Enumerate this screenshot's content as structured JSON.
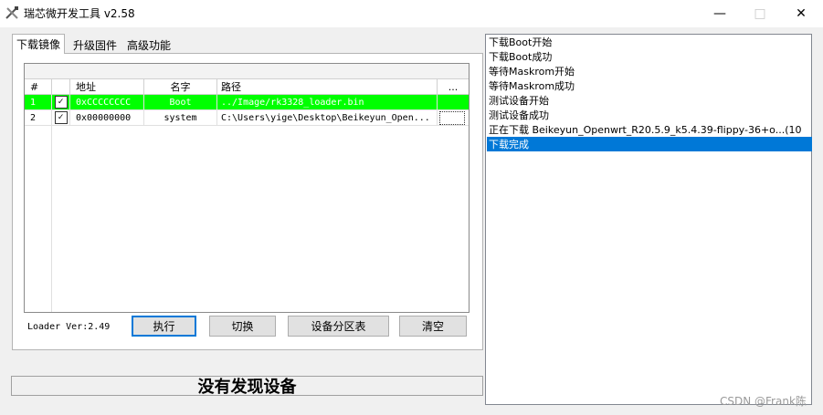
{
  "window": {
    "title": "瑞芯微开发工具 v2.58",
    "minimize_icon": "minimize-icon",
    "maximize_icon": "maximize-icon",
    "close_icon": "close-icon"
  },
  "tabs": [
    {
      "label": "下载镜像",
      "active": true
    },
    {
      "label": "升级固件",
      "active": false
    },
    {
      "label": "高级功能",
      "active": false
    }
  ],
  "table": {
    "headers": {
      "num": "#",
      "check": "",
      "address": "地址",
      "name": "名字",
      "path": "路径",
      "more": "..."
    },
    "rows": [
      {
        "num": "1",
        "checked": true,
        "address": "0xCCCCCCCC",
        "name": "Boot",
        "path": "../Image/rk3328_loader.bin"
      },
      {
        "num": "2",
        "checked": true,
        "address": "0x00000000",
        "name": "system",
        "path": "C:\\Users\\yige\\Desktop\\Beikeyun_Open..."
      }
    ],
    "highlight_color": "#00ff00"
  },
  "loader_version": "Loader Ver:2.49",
  "buttons": {
    "run": "执行",
    "switch": "切换",
    "partition": "设备分区表",
    "clear": "清空"
  },
  "status": "没有发现设备",
  "log": [
    "下载Boot开始",
    "下载Boot成功",
    "等待Maskrom开始",
    "等待Maskrom成功",
    "测试设备开始",
    "测试设备成功",
    "正在下载 Beikeyun_Openwrt_R20.5.9_k5.4.39-flippy-36+o...(10",
    "下载完成"
  ],
  "log_selected_index": 7,
  "watermark": "CSDN @Frank陈",
  "colors": {
    "accent": "#0078d7"
  }
}
